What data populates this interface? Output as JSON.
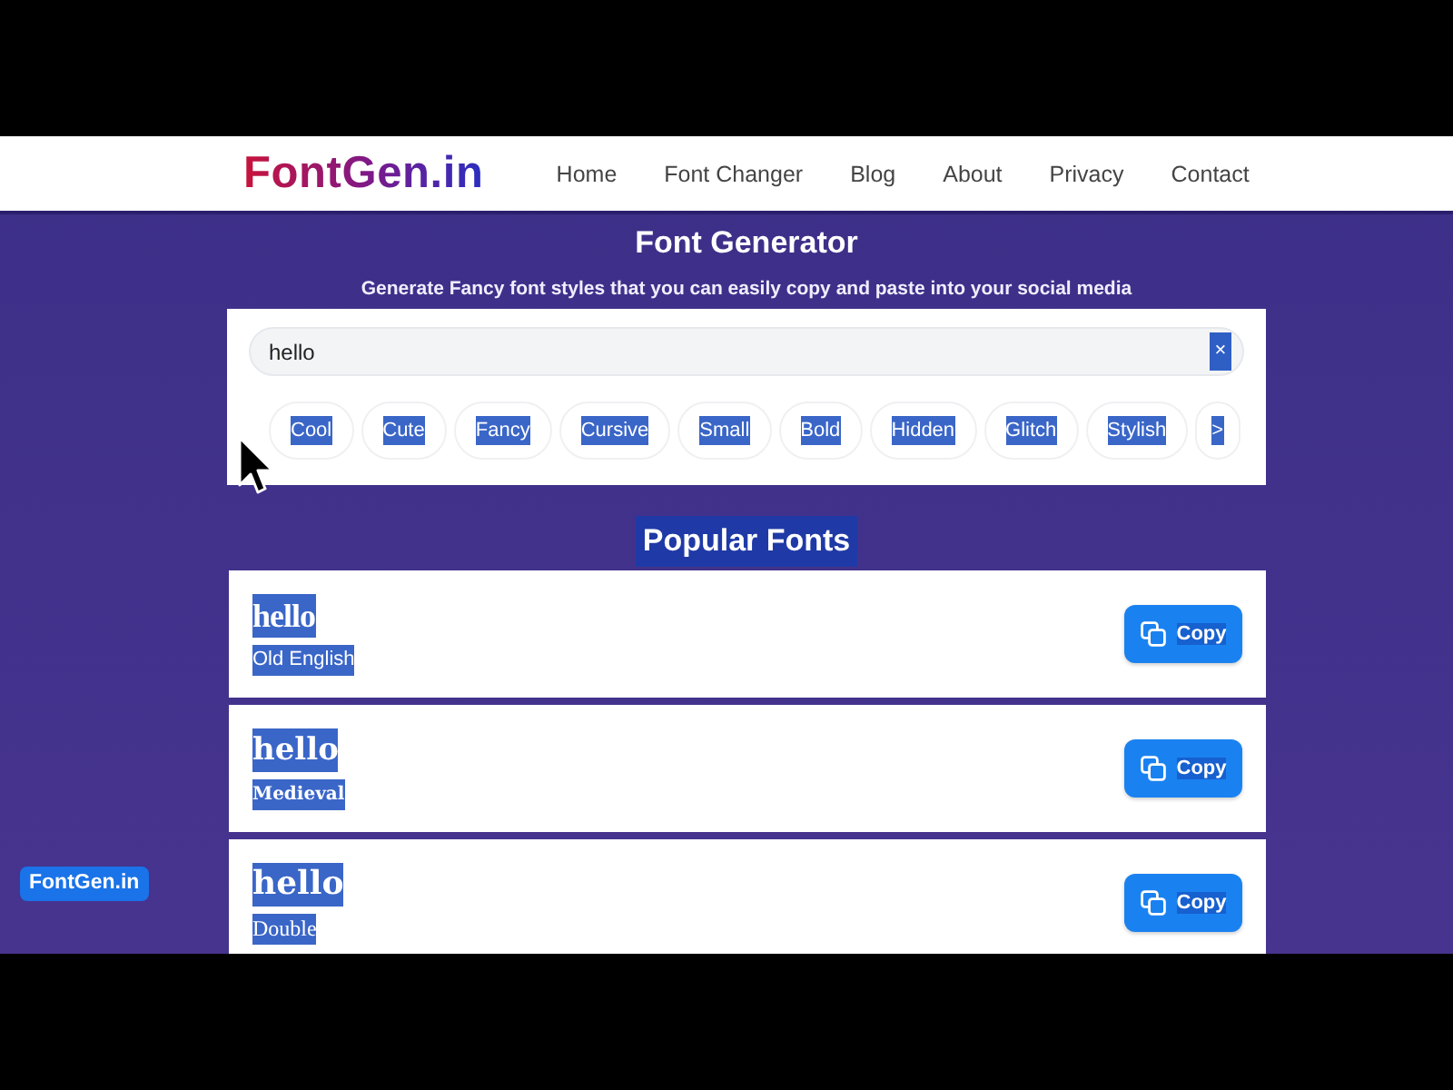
{
  "header": {
    "logo": "FontGen.in",
    "nav": [
      "Home",
      "Font Changer",
      "Blog",
      "About",
      "Privacy",
      "Contact"
    ]
  },
  "hero": {
    "title": "Font Generator",
    "subtitle": "Generate Fancy font styles that you can easily copy and paste into your social media"
  },
  "generator": {
    "input": {
      "value": "hello"
    },
    "clear_button": "×",
    "styles": [
      {
        "label": "Cool",
        "highlighted": true
      },
      {
        "label": "Cute",
        "highlighted": true
      },
      {
        "label": "Fancy",
        "highlighted": true
      },
      {
        "label": "Cursive",
        "highlighted": true
      },
      {
        "label": "Small",
        "highlighted": true
      },
      {
        "label": "Bold",
        "highlighted": true
      },
      {
        "label": "Hidden",
        "highlighted": true
      },
      {
        "label": "Glitch",
        "highlighted": true
      },
      {
        "label": "Stylish",
        "highlighted": true
      }
    ],
    "next_button": {
      "label": ">",
      "highlighted": true
    }
  },
  "popular": {
    "heading": "Popular Fonts",
    "heading_highlighted": true,
    "fonts": [
      {
        "kind": "old-english",
        "preview": "hello",
        "name": "Old English",
        "highlighted": true,
        "copy_label": "Copy"
      },
      {
        "kind": "medieval",
        "preview": "hello",
        "name": "Medieval",
        "highlighted": true,
        "copy_label": "Copy"
      },
      {
        "kind": "double",
        "preview": "hello",
        "name": "Double",
        "highlighted": true,
        "copy_label": "Copy"
      }
    ]
  },
  "floating_badge": "FontGen.in"
}
